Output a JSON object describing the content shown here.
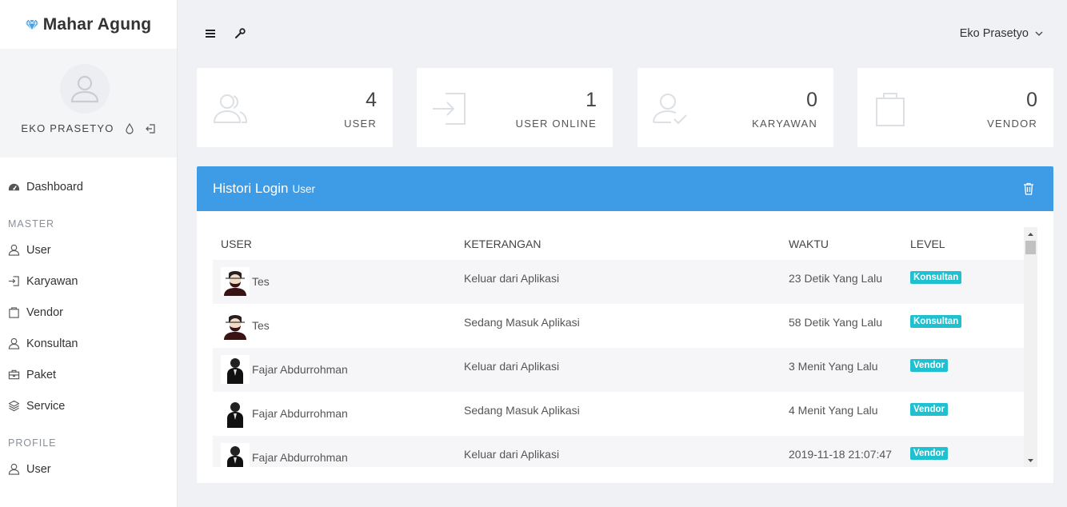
{
  "brand": {
    "name": "Mahar Agung",
    "accent": "#3e9be6"
  },
  "profile": {
    "name": "EKO PRASETYO"
  },
  "nav": {
    "dashboard": "Dashboard",
    "sections": [
      {
        "title": "MASTER",
        "items": [
          "User",
          "Karyawan",
          "Vendor",
          "Konsultan",
          "Paket",
          "Service"
        ]
      },
      {
        "title": "PROFILE",
        "items": [
          "User"
        ]
      }
    ]
  },
  "topbar": {
    "user_name": "Eko Prasetyo"
  },
  "cards": [
    {
      "value": "4",
      "label": "USER",
      "icon": "users-icon"
    },
    {
      "value": "1",
      "label": "USER ONLINE",
      "icon": "sign-in-icon"
    },
    {
      "value": "0",
      "label": "KARYAWAN",
      "icon": "user-check-icon"
    },
    {
      "value": "0",
      "label": "VENDOR",
      "icon": "shopping-bag-icon"
    }
  ],
  "panel": {
    "title": "Histori Login",
    "subtitle": "User",
    "columns": [
      "USER",
      "KETERANGAN",
      "WAKTU",
      "LEVEL"
    ],
    "rows": [
      {
        "user": "Tes",
        "keterangan": "Keluar dari Aplikasi",
        "waktu": "23 Detik Yang Lalu",
        "level": "Konsultan"
      },
      {
        "user": "Tes",
        "keterangan": "Sedang Masuk Aplikasi",
        "waktu": "58 Detik Yang Lalu",
        "level": "Konsultan"
      },
      {
        "user": "Fajar Abdurrohman",
        "keterangan": "Keluar dari Aplikasi",
        "waktu": "3 Menit Yang Lalu",
        "level": "Vendor"
      },
      {
        "user": "Fajar Abdurrohman",
        "keterangan": "Sedang Masuk Aplikasi",
        "waktu": "4 Menit Yang Lalu",
        "level": "Vendor"
      },
      {
        "user": "Fajar Abdurrohman",
        "keterangan": "Keluar dari Aplikasi",
        "waktu": "2019-11-18 21:07:47",
        "level": "Vendor"
      }
    ]
  }
}
